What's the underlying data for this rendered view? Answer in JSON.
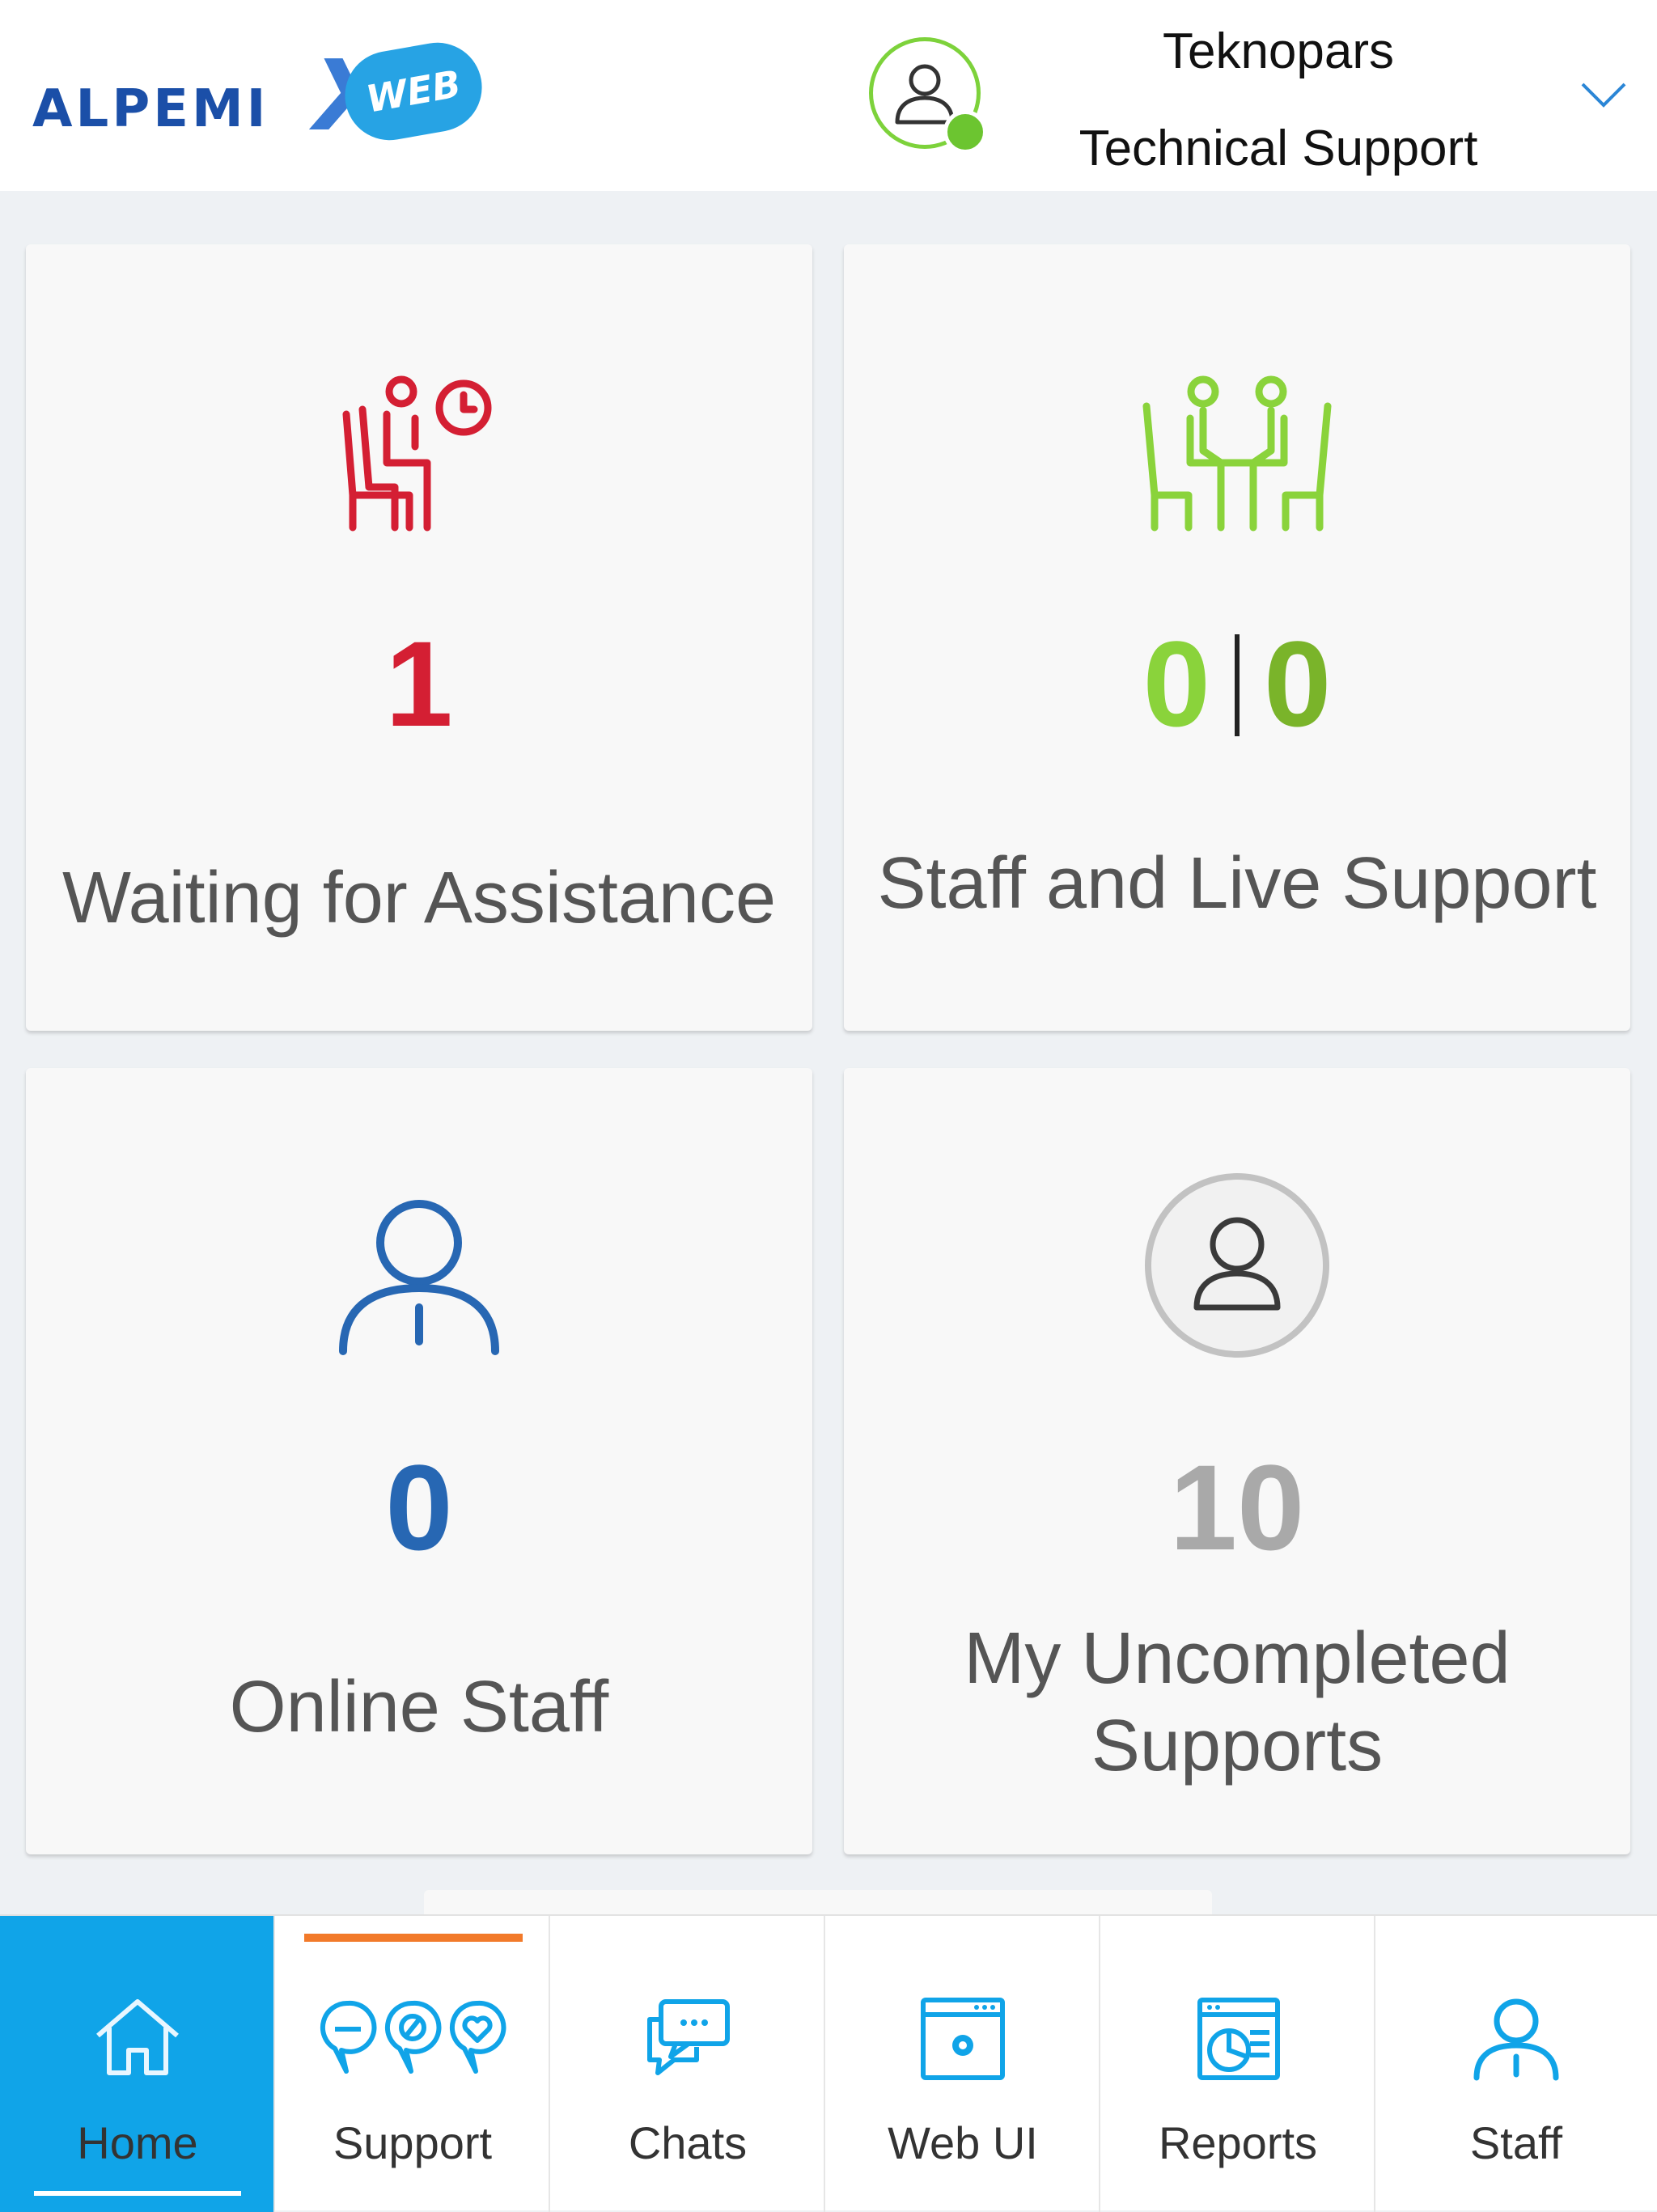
{
  "header": {
    "logo_text": "ALPEMI",
    "logo_x": "X",
    "logo_badge": "WEB",
    "company": "Teknopars",
    "department": "Technical Support",
    "status_color": "#6cc530"
  },
  "cards": [
    {
      "id": "waiting",
      "icon": "waiting-person-clock-icon",
      "value": "1",
      "label": "Waiting for Assistance",
      "color": "#d41f33"
    },
    {
      "id": "staff-live",
      "icon": "two-people-table-icon",
      "value_a": "0",
      "value_b": "0",
      "label": "Staff and Live Support",
      "color": "#8ad33b"
    },
    {
      "id": "online-staff",
      "icon": "staff-person-icon",
      "value": "0",
      "label": "Online Staff",
      "color": "#2767b3"
    },
    {
      "id": "uncompleted",
      "icon": "user-circle-icon",
      "value": "10",
      "label_line1": "My Uncompleted",
      "label_line2": "Supports",
      "color": "#a9a9a9"
    }
  ],
  "nav": {
    "items": [
      {
        "label": "Home",
        "icon": "home-icon",
        "active": true
      },
      {
        "label": "Support",
        "icon": "support-bubbles-icon",
        "active": false
      },
      {
        "label": "Chats",
        "icon": "chat-bubbles-icon",
        "active": false
      },
      {
        "label": "Web UI",
        "icon": "web-window-gear-icon",
        "active": false
      },
      {
        "label": "Reports",
        "icon": "report-chart-icon",
        "active": false
      },
      {
        "label": "Staff",
        "icon": "staff-icon",
        "active": false
      }
    ],
    "active_color": "#10a4e8",
    "indicator_color": "#f27a2a"
  }
}
